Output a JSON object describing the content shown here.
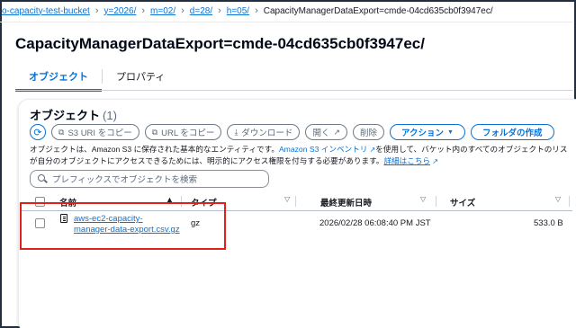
{
  "breadcrumb": {
    "items": [
      {
        "label": "o-capacity-test-bucket"
      },
      {
        "label": "y=2026/"
      },
      {
        "label": "m=02/"
      },
      {
        "label": "d=28/"
      },
      {
        "label": "h=05/"
      }
    ],
    "current": "CapacityManagerDataExport=cmde-04cd635cb0f3947ec/"
  },
  "page_title": "CapacityManagerDataExport=cmde-04cd635cb0f3947ec/",
  "tabs": [
    {
      "label": "オブジェクト",
      "active": true
    },
    {
      "label": "プロパティ",
      "active": false
    }
  ],
  "objects_panel": {
    "title": "オブジェクト",
    "count": "(1)",
    "toolbar": {
      "refresh_icon": "refresh-icon",
      "copy_s3_uri": "S3 URI をコピー",
      "copy_url": "URL をコピー",
      "download": "ダウンロード",
      "open": "開く",
      "delete": "削除",
      "actions": "アクション",
      "create_folder": "フォルダの作成"
    },
    "description": {
      "line1_pre": "オブジェクトは、Amazon S3 に保存された基本的なエンティティです。",
      "line1_link": "Amazon S3 インベントリ",
      "line1_post": "を使用して、バケット内のすべてのオブジェクトのリス",
      "line2_pre": "が自分のオブジェクトにアクセスできるためには、明示的にアクセス権限を付与する必要があります。",
      "line2_link": "詳細はこちら"
    },
    "search_placeholder": "プレフィックスでオブジェクトを検索",
    "columns": {
      "name": "名前",
      "type": "タイプ",
      "last_modified": "最終更新日時",
      "size": "サイズ"
    },
    "rows": [
      {
        "name_line1": "aws-ec2-capacity-",
        "name_line2": "manager-data-export.csv.gz",
        "type": "gz",
        "last_modified": "2026/02/28 06:08:40 PM JST",
        "size": "533.0 B"
      }
    ]
  },
  "colors": {
    "link": "#0972d3",
    "highlight": "#e0201b"
  }
}
